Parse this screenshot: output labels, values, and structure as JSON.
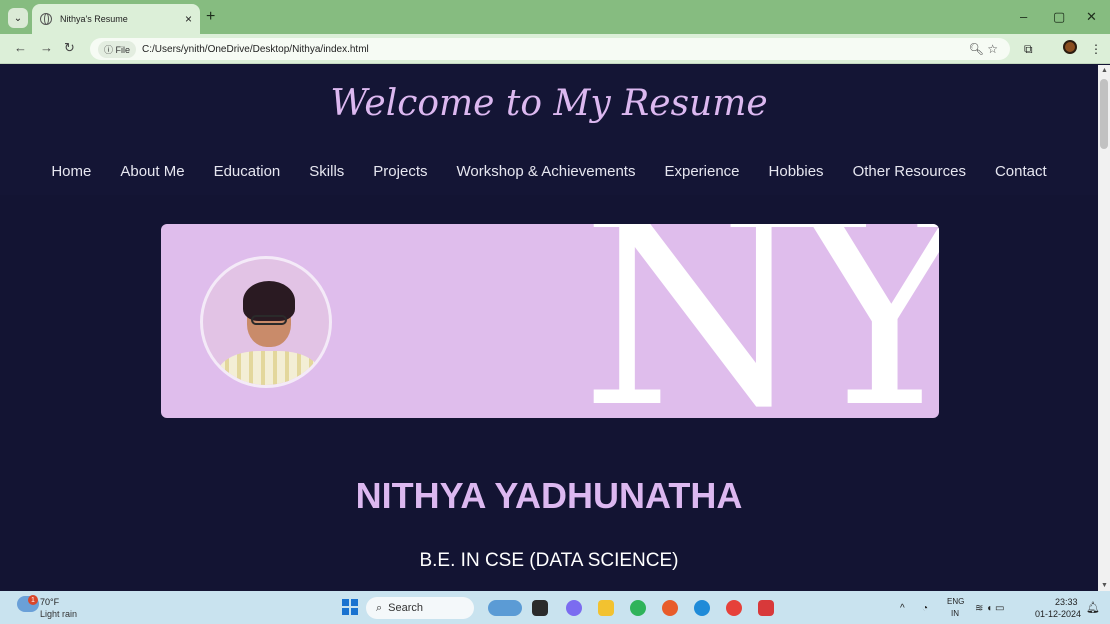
{
  "browser": {
    "tab_title": "Nithya's Resume",
    "tab_close": "×",
    "new_tab": "+",
    "file_chip": "ⓘ File",
    "url": "C:/Users/ynith/OneDrive/Desktop/Nithya/index.html",
    "minimize": "–",
    "restore": "▢",
    "close": "✕"
  },
  "site": {
    "title": "Welcome to My Resume",
    "nav": [
      "Home",
      "About Me",
      "Education",
      "Skills",
      "Projects",
      "Workshop & Achievements",
      "Experience",
      "Hobbies",
      "Other Resources",
      "Contact"
    ],
    "banner_letters": "NY",
    "name": "NITHYA YADHUNATHA",
    "degree": "B.E. IN CSE (DATA SCIENCE)"
  },
  "taskbar": {
    "weather_badge": "1",
    "temperature": "70°F",
    "weather": "Light rain",
    "search": "Search",
    "lang_top": "ENG",
    "lang_bottom": "IN",
    "time": "23:33",
    "date": "01-12-2024"
  },
  "colors": {
    "accent": "#dcb8f0",
    "page_bg": "#131433",
    "banner_bg": "#dfbdec",
    "titlebar": "#86bc80"
  }
}
